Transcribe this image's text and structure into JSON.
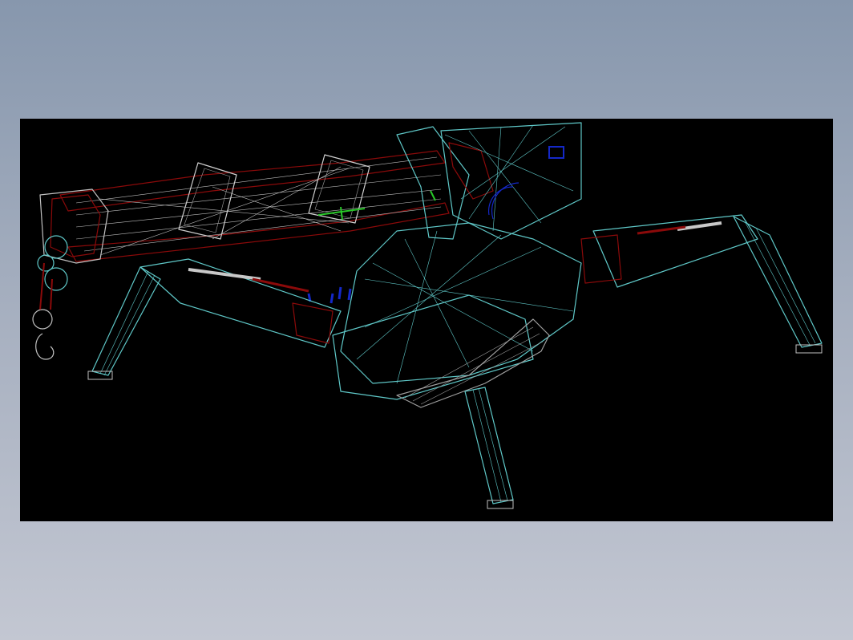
{
  "scene": {
    "background_color": "#000000",
    "model": "spider-crane-wireframe",
    "colors": {
      "frame": "#5fc8c8",
      "accent": "#8b0a0a",
      "cable": "#c8c8c8",
      "hydraulic": "#1428c8",
      "marker": "#28c828"
    }
  }
}
